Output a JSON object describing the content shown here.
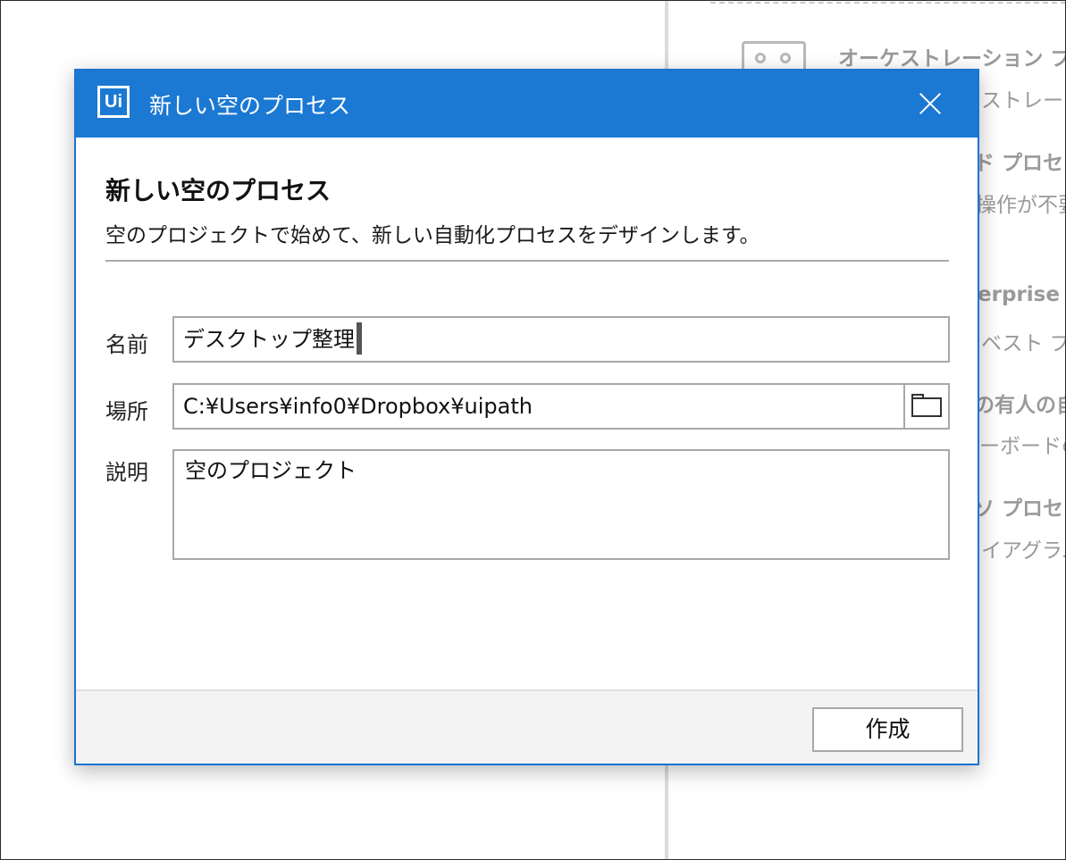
{
  "background": {
    "panel_lines": [
      {
        "text": "オーケストレーション プロセ",
        "bold": true
      },
      {
        "text": "ストレーシ",
        "bold": false
      },
      {
        "text": "ド プロセス",
        "bold": true
      },
      {
        "text": "操作が不要",
        "bold": false
      },
      {
        "text": "erprise F",
        "bold": true
      },
      {
        "text": "ベスト プラ",
        "bold": false
      },
      {
        "text": "の有人の自",
        "bold": true
      },
      {
        "text": "ーボードのエ",
        "bold": false
      },
      {
        "text": "ソ プロセス",
        "bold": true
      },
      {
        "text": "イアグラム",
        "bold": false
      }
    ]
  },
  "dialog": {
    "logo_text": "Ui",
    "window_title": "新しい空のプロセス",
    "heading": "新しい空のプロセス",
    "description": "空のプロジェクトで始めて、新しい自動化プロセスをデザインします。",
    "fields": {
      "name_label": "名前",
      "name_value": "デスクトップ整理",
      "location_label": "場所",
      "location_value": "C:¥Users¥info0¥Dropbox¥uipath",
      "description_label": "説明",
      "description_value": "空のプロジェクト"
    },
    "create_button": "作成"
  },
  "colors": {
    "titlebar": "#1b78d3",
    "dialog_border": "#1b73d2",
    "footer": "#f3f3f3",
    "background_text": "#9a9a9a"
  },
  "icons": [
    "ui-logo-icon",
    "close-icon",
    "folder-icon",
    "orchestration-icon"
  ]
}
